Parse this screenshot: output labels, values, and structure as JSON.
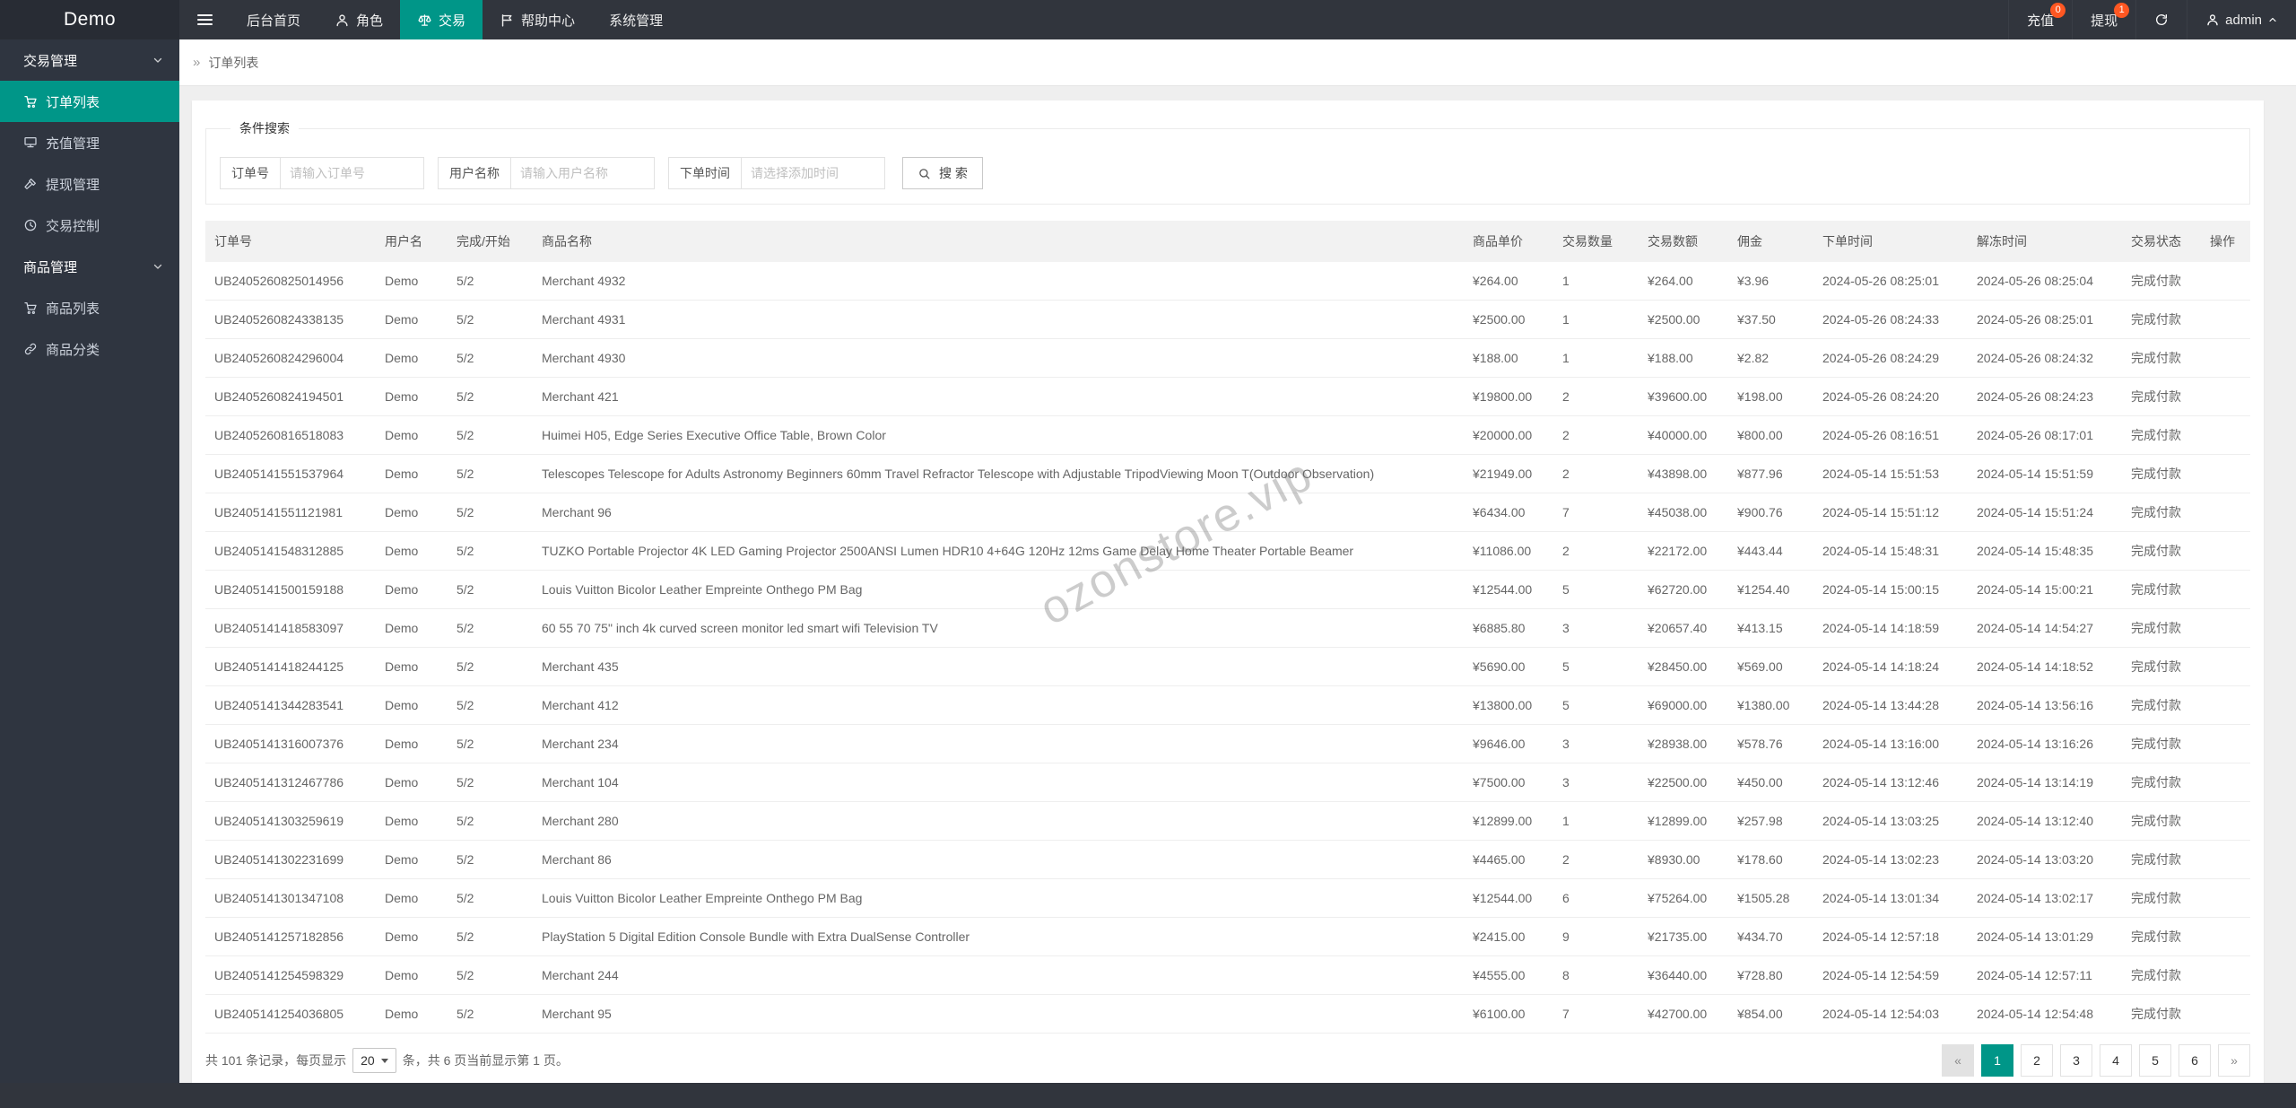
{
  "colors": {
    "accent": "#009688",
    "badge": "#ff5722",
    "header_bg": "#31353d",
    "sidebar_bg": "#2f3540"
  },
  "header": {
    "logo": "Demo",
    "nav": [
      {
        "label": "后台首页"
      },
      {
        "label": "角色",
        "icon": "user"
      },
      {
        "label": "交易",
        "icon": "scales",
        "active": true
      },
      {
        "label": "帮助中心",
        "icon": "flag"
      },
      {
        "label": "系统管理"
      }
    ],
    "actions": {
      "recharge": {
        "label": "充值",
        "badge": "0"
      },
      "withdraw": {
        "label": "提现",
        "badge": "1"
      },
      "username": "admin"
    }
  },
  "sidebar": {
    "group1": {
      "label": "交易管理",
      "items": [
        {
          "label": "订单列表",
          "icon": "cart",
          "active": true
        },
        {
          "label": "充值管理",
          "icon": "board"
        },
        {
          "label": "提现管理",
          "icon": "gavel"
        },
        {
          "label": "交易控制",
          "icon": "clock"
        }
      ]
    },
    "group2": {
      "label": "商品管理",
      "items": [
        {
          "label": "商品列表",
          "icon": "cart"
        },
        {
          "label": "商品分类",
          "icon": "link"
        }
      ]
    }
  },
  "breadcrumb": {
    "separator": "»",
    "current": "订单列表"
  },
  "search": {
    "legend": "条件搜索",
    "fields": [
      {
        "label": "订单号",
        "placeholder": "请输入订单号"
      },
      {
        "label": "用户名称",
        "placeholder": "请输入用户名称"
      },
      {
        "label": "下单时间",
        "placeholder": "请选择添加时间"
      }
    ],
    "button_label": "搜 索"
  },
  "table": {
    "columns": [
      "订单号",
      "用户名",
      "完成/开始",
      "商品名称",
      "商品单价",
      "交易数量",
      "交易数额",
      "佣金",
      "下单时间",
      "解冻时间",
      "交易状态",
      "操作"
    ],
    "rows": [
      [
        "UB2405260825014956",
        "Demo",
        "5/2",
        "Merchant 4932",
        "¥264.00",
        "1",
        "¥264.00",
        "¥3.96",
        "2024-05-26 08:25:01",
        "2024-05-26 08:25:04",
        "完成付款",
        ""
      ],
      [
        "UB2405260824338135",
        "Demo",
        "5/2",
        "Merchant 4931",
        "¥2500.00",
        "1",
        "¥2500.00",
        "¥37.50",
        "2024-05-26 08:24:33",
        "2024-05-26 08:25:01",
        "完成付款",
        ""
      ],
      [
        "UB2405260824296004",
        "Demo",
        "5/2",
        "Merchant 4930",
        "¥188.00",
        "1",
        "¥188.00",
        "¥2.82",
        "2024-05-26 08:24:29",
        "2024-05-26 08:24:32",
        "完成付款",
        ""
      ],
      [
        "UB2405260824194501",
        "Demo",
        "5/2",
        "Merchant 421",
        "¥19800.00",
        "2",
        "¥39600.00",
        "¥198.00",
        "2024-05-26 08:24:20",
        "2024-05-26 08:24:23",
        "完成付款",
        ""
      ],
      [
        "UB2405260816518083",
        "Demo",
        "5/2",
        "Huimei H05, Edge Series Executive Office Table, Brown Color",
        "¥20000.00",
        "2",
        "¥40000.00",
        "¥800.00",
        "2024-05-26 08:16:51",
        "2024-05-26 08:17:01",
        "完成付款",
        ""
      ],
      [
        "UB2405141551537964",
        "Demo",
        "5/2",
        "Telescopes Telescope for Adults Astronomy Beginners 60mm Travel Refractor Telescope with Adjustable TripodViewing Moon T(Outdoor Observation)",
        "¥21949.00",
        "2",
        "¥43898.00",
        "¥877.96",
        "2024-05-14 15:51:53",
        "2024-05-14 15:51:59",
        "完成付款",
        ""
      ],
      [
        "UB2405141551121981",
        "Demo",
        "5/2",
        "Merchant 96",
        "¥6434.00",
        "7",
        "¥45038.00",
        "¥900.76",
        "2024-05-14 15:51:12",
        "2024-05-14 15:51:24",
        "完成付款",
        ""
      ],
      [
        "UB2405141548312885",
        "Demo",
        "5/2",
        "TUZKO Portable Projector 4K LED Gaming Projector 2500ANSI Lumen HDR10 4+64G 120Hz 12ms Game Delay Home Theater Portable Beamer",
        "¥11086.00",
        "2",
        "¥22172.00",
        "¥443.44",
        "2024-05-14 15:48:31",
        "2024-05-14 15:48:35",
        "完成付款",
        ""
      ],
      [
        "UB2405141500159188",
        "Demo",
        "5/2",
        "Louis Vuitton Bicolor Leather Empreinte Onthego PM Bag",
        "¥12544.00",
        "5",
        "¥62720.00",
        "¥1254.40",
        "2024-05-14 15:00:15",
        "2024-05-14 15:00:21",
        "完成付款",
        ""
      ],
      [
        "UB2405141418583097",
        "Demo",
        "5/2",
        "60 55 70 75\" inch 4k curved screen monitor led smart wifi Television TV",
        "¥6885.80",
        "3",
        "¥20657.40",
        "¥413.15",
        "2024-05-14 14:18:59",
        "2024-05-14 14:54:27",
        "完成付款",
        ""
      ],
      [
        "UB2405141418244125",
        "Demo",
        "5/2",
        "Merchant 435",
        "¥5690.00",
        "5",
        "¥28450.00",
        "¥569.00",
        "2024-05-14 14:18:24",
        "2024-05-14 14:18:52",
        "完成付款",
        ""
      ],
      [
        "UB2405141344283541",
        "Demo",
        "5/2",
        "Merchant 412",
        "¥13800.00",
        "5",
        "¥69000.00",
        "¥1380.00",
        "2024-05-14 13:44:28",
        "2024-05-14 13:56:16",
        "完成付款",
        ""
      ],
      [
        "UB2405141316007376",
        "Demo",
        "5/2",
        "Merchant 234",
        "¥9646.00",
        "3",
        "¥28938.00",
        "¥578.76",
        "2024-05-14 13:16:00",
        "2024-05-14 13:16:26",
        "完成付款",
        ""
      ],
      [
        "UB2405141312467786",
        "Demo",
        "5/2",
        "Merchant 104",
        "¥7500.00",
        "3",
        "¥22500.00",
        "¥450.00",
        "2024-05-14 13:12:46",
        "2024-05-14 13:14:19",
        "完成付款",
        ""
      ],
      [
        "UB2405141303259619",
        "Demo",
        "5/2",
        "Merchant 280",
        "¥12899.00",
        "1",
        "¥12899.00",
        "¥257.98",
        "2024-05-14 13:03:25",
        "2024-05-14 13:12:40",
        "完成付款",
        ""
      ],
      [
        "UB2405141302231699",
        "Demo",
        "5/2",
        "Merchant 86",
        "¥4465.00",
        "2",
        "¥8930.00",
        "¥178.60",
        "2024-05-14 13:02:23",
        "2024-05-14 13:03:20",
        "完成付款",
        ""
      ],
      [
        "UB2405141301347108",
        "Demo",
        "5/2",
        "Louis Vuitton Bicolor Leather Empreinte Onthego PM Bag",
        "¥12544.00",
        "6",
        "¥75264.00",
        "¥1505.28",
        "2024-05-14 13:01:34",
        "2024-05-14 13:02:17",
        "完成付款",
        ""
      ],
      [
        "UB2405141257182856",
        "Demo",
        "5/2",
        "PlayStation 5 Digital Edition Console Bundle with Extra DualSense Controller",
        "¥2415.00",
        "9",
        "¥21735.00",
        "¥434.70",
        "2024-05-14 12:57:18",
        "2024-05-14 13:01:29",
        "完成付款",
        ""
      ],
      [
        "UB2405141254598329",
        "Demo",
        "5/2",
        "Merchant 244",
        "¥4555.00",
        "8",
        "¥36440.00",
        "¥728.80",
        "2024-05-14 12:54:59",
        "2024-05-14 12:57:11",
        "完成付款",
        ""
      ],
      [
        "UB2405141254036805",
        "Demo",
        "5/2",
        "Merchant 95",
        "¥6100.00",
        "7",
        "¥42700.00",
        "¥854.00",
        "2024-05-14 12:54:03",
        "2024-05-14 12:54:48",
        "完成付款",
        ""
      ]
    ]
  },
  "pagination": {
    "summary_prefix": "共 101 条记录，每页显示",
    "page_size": "20",
    "summary_suffix": "条，共 6 页当前显示第 1 页。",
    "pages": [
      {
        "label": "«",
        "kind": "prev"
      },
      {
        "label": "1",
        "kind": "page",
        "active": true
      },
      {
        "label": "2",
        "kind": "page"
      },
      {
        "label": "3",
        "kind": "page"
      },
      {
        "label": "4",
        "kind": "page"
      },
      {
        "label": "5",
        "kind": "page"
      },
      {
        "label": "6",
        "kind": "page"
      },
      {
        "label": "»",
        "kind": "next"
      }
    ]
  },
  "watermark": "ozonstore.vip"
}
